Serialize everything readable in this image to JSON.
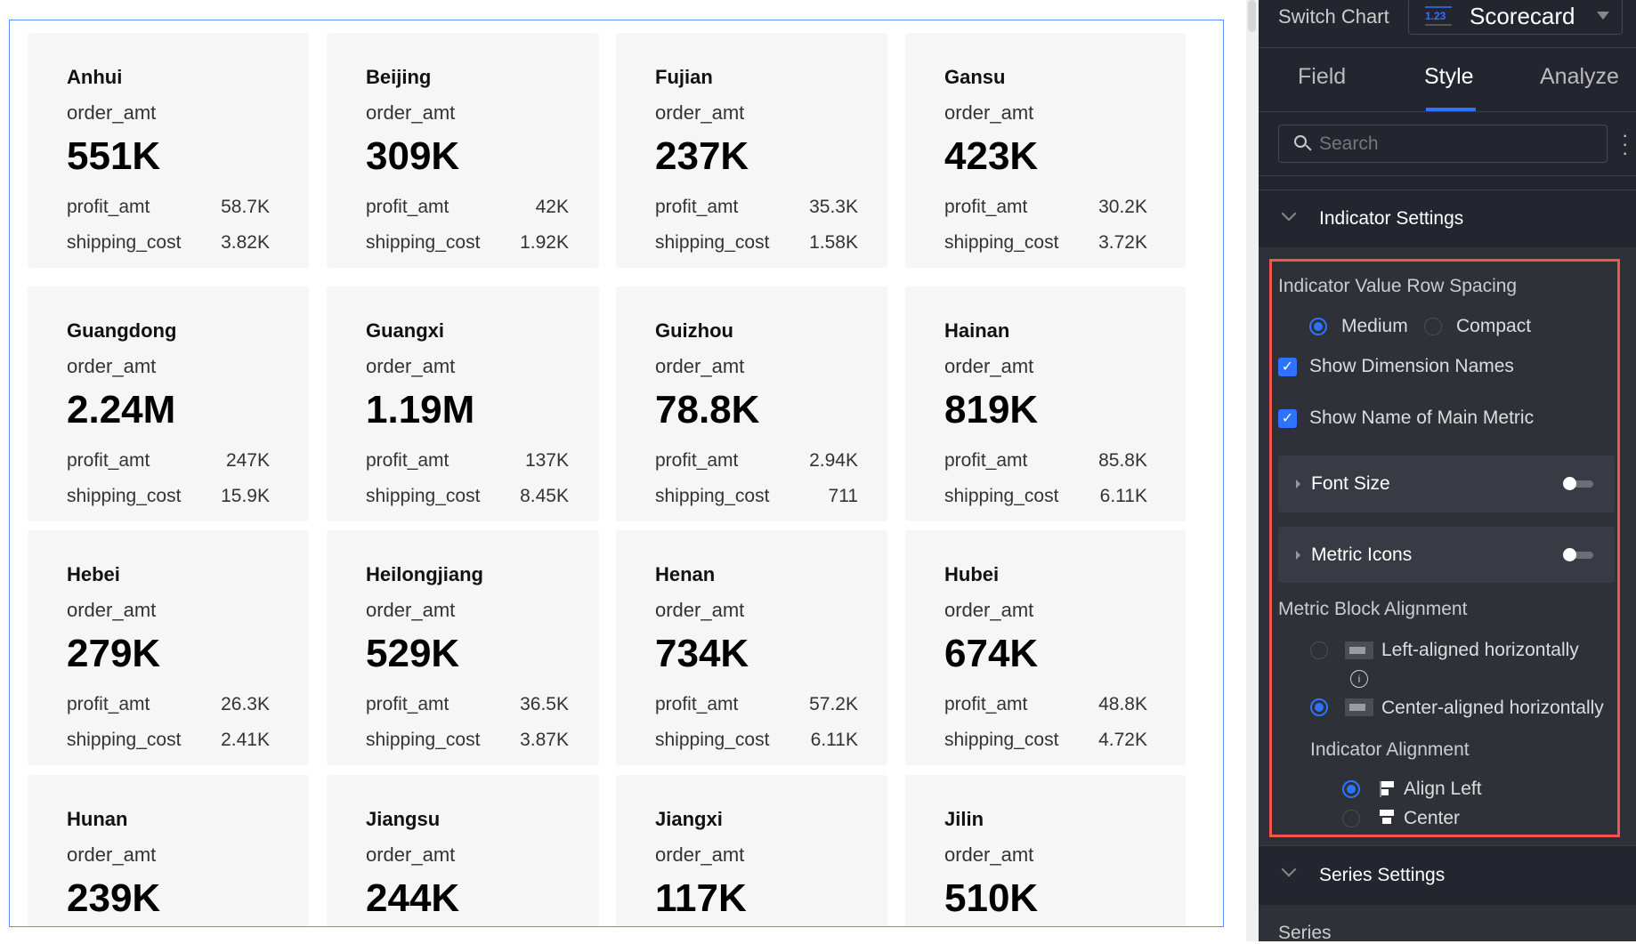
{
  "cards": [
    {
      "dim": "Anhui",
      "main": "order_amt",
      "value": "551K",
      "subs": [
        [
          "profit_amt",
          "58.7K"
        ],
        [
          "shipping_cost",
          "3.82K"
        ]
      ]
    },
    {
      "dim": "Beijing",
      "main": "order_amt",
      "value": "309K",
      "subs": [
        [
          "profit_amt",
          "42K"
        ],
        [
          "shipping_cost",
          "1.92K"
        ]
      ]
    },
    {
      "dim": "Fujian",
      "main": "order_amt",
      "value": "237K",
      "subs": [
        [
          "profit_amt",
          "35.3K"
        ],
        [
          "shipping_cost",
          "1.58K"
        ]
      ]
    },
    {
      "dim": "Gansu",
      "main": "order_amt",
      "value": "423K",
      "subs": [
        [
          "profit_amt",
          "30.2K"
        ],
        [
          "shipping_cost",
          "3.72K"
        ]
      ]
    },
    {
      "dim": "Guangdong",
      "main": "order_amt",
      "value": "2.24M",
      "subs": [
        [
          "profit_amt",
          "247K"
        ],
        [
          "shipping_cost",
          "15.9K"
        ]
      ]
    },
    {
      "dim": "Guangxi",
      "main": "order_amt",
      "value": "1.19M",
      "subs": [
        [
          "profit_amt",
          "137K"
        ],
        [
          "shipping_cost",
          "8.45K"
        ]
      ]
    },
    {
      "dim": "Guizhou",
      "main": "order_amt",
      "value": "78.8K",
      "subs": [
        [
          "profit_amt",
          "2.94K"
        ],
        [
          "shipping_cost",
          "711"
        ]
      ]
    },
    {
      "dim": "Hainan",
      "main": "order_amt",
      "value": "819K",
      "subs": [
        [
          "profit_amt",
          "85.8K"
        ],
        [
          "shipping_cost",
          "6.11K"
        ]
      ]
    },
    {
      "dim": "Hebei",
      "main": "order_amt",
      "value": "279K",
      "subs": [
        [
          "profit_amt",
          "26.3K"
        ],
        [
          "shipping_cost",
          "2.41K"
        ]
      ]
    },
    {
      "dim": "Heilongjiang",
      "main": "order_amt",
      "value": "529K",
      "subs": [
        [
          "profit_amt",
          "36.5K"
        ],
        [
          "shipping_cost",
          "3.87K"
        ]
      ]
    },
    {
      "dim": "Henan",
      "main": "order_amt",
      "value": "734K",
      "subs": [
        [
          "profit_amt",
          "57.2K"
        ],
        [
          "shipping_cost",
          "6.11K"
        ]
      ]
    },
    {
      "dim": "Hubei",
      "main": "order_amt",
      "value": "674K",
      "subs": [
        [
          "profit_amt",
          "48.8K"
        ],
        [
          "shipping_cost",
          "4.72K"
        ]
      ]
    },
    {
      "dim": "Hunan",
      "main": "order_amt",
      "value": "239K",
      "subs": []
    },
    {
      "dim": "Jiangsu",
      "main": "order_amt",
      "value": "244K",
      "subs": []
    },
    {
      "dim": "Jiangxi",
      "main": "order_amt",
      "value": "117K",
      "subs": []
    },
    {
      "dim": "Jilin",
      "main": "order_amt",
      "value": "510K",
      "subs": []
    }
  ],
  "panel": {
    "switch_chart": "Switch Chart",
    "chart_type": "Scorecard",
    "chart_icon_text": "1.23",
    "tabs": [
      {
        "label": "Field"
      },
      {
        "label": "Style",
        "active": true
      },
      {
        "label": "Analyze"
      }
    ],
    "search_placeholder": "Search",
    "indicator_settings": "Indicator Settings",
    "row_spacing_label": "Indicator Value Row Spacing",
    "row_spacing_options": [
      "Medium",
      "Compact"
    ],
    "row_spacing_selected": "Medium",
    "show_dimension_names": "Show Dimension Names",
    "show_dimension_names_checked": true,
    "show_main_metric_name": "Show Name of Main Metric",
    "show_main_metric_name_checked": true,
    "font_size": "Font Size",
    "font_size_on": false,
    "metric_icons": "Metric Icons",
    "metric_icons_on": false,
    "block_alignment_label": "Metric Block Alignment",
    "block_alignment_options": [
      "Left-aligned horizontally",
      "Center-aligned horizontally"
    ],
    "block_alignment_selected": "Center-aligned horizontally",
    "indicator_alignment_label": "Indicator Alignment",
    "indicator_alignment_options": [
      "Align Left",
      "Center"
    ],
    "indicator_alignment_selected": "Align Left",
    "series_settings": "Series Settings",
    "series": "Series"
  },
  "colors": {
    "accent": "#2e73ff",
    "highlight_box": "#f5564a",
    "panel_bg": "#23262e",
    "card_bg": "#f6f6f6"
  }
}
